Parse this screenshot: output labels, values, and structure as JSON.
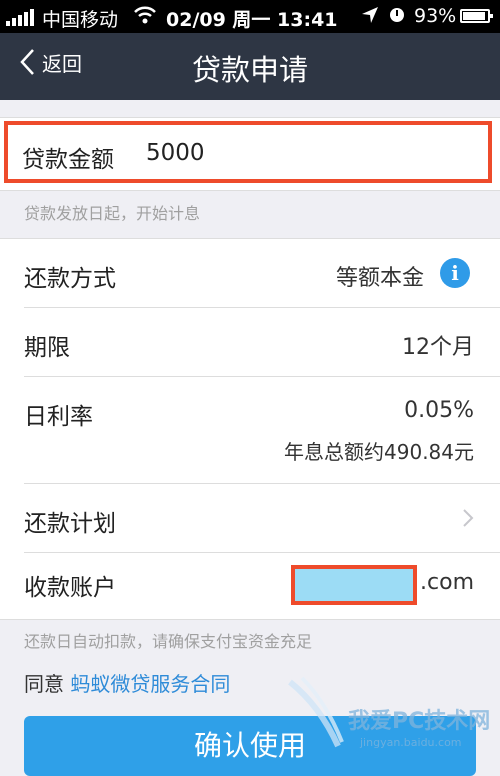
{
  "status_bar": {
    "carrier": "中国移动",
    "time": "02/09 周一 13:41",
    "battery": "93%"
  },
  "nav": {
    "back_label": "返回",
    "title": "贷款申请"
  },
  "amount": {
    "label": "贷款金额",
    "value": "5000",
    "hint": "贷款发放日起，开始计息"
  },
  "rows": {
    "repayment_method": {
      "label": "还款方式",
      "value": "等额本金"
    },
    "term": {
      "label": "期限",
      "value": "12个月"
    },
    "daily_rate": {
      "label": "日利率",
      "value": "0.05%",
      "annual_interest": "年息总额约490.84元"
    },
    "plan": {
      "label": "还款计划"
    },
    "account": {
      "label": "收款账户",
      "suffix": ".com"
    }
  },
  "auto_debit_hint": "还款日自动扣款，请确保支付宝资金充足",
  "agreement": {
    "prefix": "同意",
    "link": "蚂蚁微贷服务合同"
  },
  "confirm_label": "确认使用",
  "watermark": {
    "text": "我爱PC技术网",
    "url": "jingyan.baidu.com"
  },
  "colors": {
    "nav_bg": "#2e3644",
    "highlight": "#ee4b2b",
    "link": "#2e8bd8",
    "button": "#2fa0e8"
  }
}
